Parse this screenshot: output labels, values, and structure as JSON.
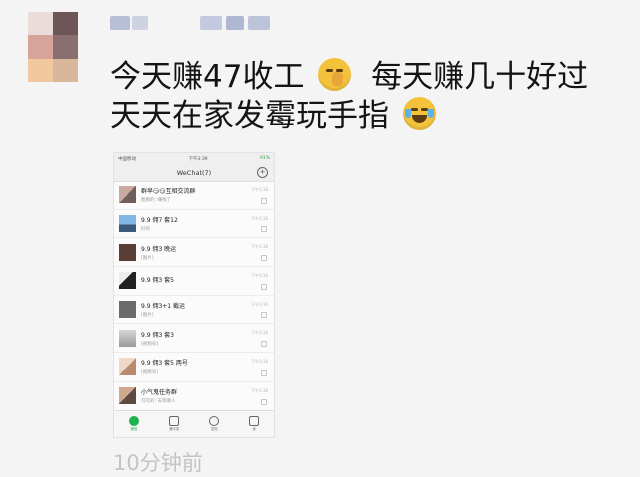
{
  "post": {
    "line1": "今天赚47收工",
    "line1b": "每天赚几十好过",
    "line2": "天天在家发霉玩手指",
    "emoji1": "shushing-face-icon",
    "emoji2": "laughing-tears-icon"
  },
  "timestamp": "10分钟前",
  "screenshot": {
    "carrier": "中国移动",
    "time": "下午3:39",
    "battery": "91%",
    "title": "WeChat(7)",
    "plus": "+",
    "chats": [
      {
        "name": "群早😏😏互相交流群",
        "sub": "图图的: 赚钱了",
        "time": "下午3:18"
      },
      {
        "name": "9.9 佣7 套12",
        "sub": "好的",
        "time": "下午3:16"
      },
      {
        "name": "9.9 佣3 晚运",
        "sub": "[图片]",
        "time": "下午3:16"
      },
      {
        "name": "9.9 佣3 套5",
        "sub": "",
        "time": "下午3:16"
      },
      {
        "name": "9.9 佣3+1 截运",
        "sub": "[图片]",
        "time": "下午3:16"
      },
      {
        "name": "9.9 佣3 套3",
        "sub": "[视频号]",
        "time": "下午3:16"
      },
      {
        "name": "9.9 佣3 套5 两号",
        "sub": "[视频号]",
        "time": "下午3:16"
      },
      {
        "name": "小气鬼任务群",
        "sub": "可可的: 去等哪人",
        "time": "下午3:16"
      }
    ],
    "tabs": [
      "微信",
      "通讯录",
      "发现",
      "我"
    ]
  },
  "colors": {
    "accent": "#20b24c",
    "avatar": [
      "#b78a8a",
      "#7a5a5c",
      "#e7b9a6",
      "#a58c88",
      "#f2cfa8",
      "#d9bd9c"
    ]
  }
}
